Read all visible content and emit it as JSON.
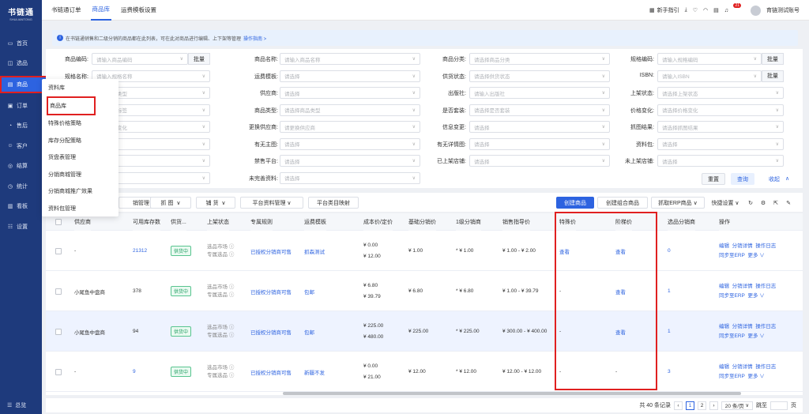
{
  "brand": {
    "name": "书链通",
    "sub": "SHULIANTONG"
  },
  "sidebar": {
    "items": [
      {
        "label": "首页",
        "icon": "monitor-icon"
      },
      {
        "label": "选品",
        "icon": "select-icon"
      },
      {
        "label": "商品",
        "icon": "goods-icon"
      },
      {
        "label": "订单",
        "icon": "order-icon"
      },
      {
        "label": "售后",
        "icon": "aftersale-icon"
      },
      {
        "label": "客户",
        "icon": "customer-icon"
      },
      {
        "label": "结算",
        "icon": "settle-icon"
      },
      {
        "label": "统计",
        "icon": "stats-icon"
      },
      {
        "label": "看板",
        "icon": "board-icon"
      },
      {
        "label": "设置",
        "icon": "settings-icon"
      }
    ],
    "bottom_label": "总览"
  },
  "topbar": {
    "tabs": [
      "书链通订单",
      "商品库",
      "运费模板设置"
    ],
    "active_tab": 1,
    "guide": "新手指引",
    "badge": "21",
    "account": "育链测试账号"
  },
  "notice": {
    "text": "在书链通销售和二级分销的商品都在此列表，可在此对商品进行编辑、上下架等管理",
    "link": "操作指南 >"
  },
  "dropdown": [
    "资料库",
    "商品库",
    "特殊价格策略",
    "库存分配策略",
    "货盘表管理",
    "分销商城管理",
    "分销商城推广效果",
    "资料包管理"
  ],
  "filters": {
    "row1": [
      {
        "label": "商品编码:",
        "placeholder": "请输入商品编码",
        "btn": "批量"
      },
      {
        "label": "商品名称:",
        "placeholder": "请输入商品名称"
      },
      {
        "label": "商品分类:",
        "placeholder": "请选择商品分类"
      },
      {
        "label": "规格编码:",
        "placeholder": "请输入规格编码",
        "btn": "批量"
      }
    ],
    "row2": [
      {
        "label": "规格名称:",
        "placeholder": "请输入规格名称"
      },
      {
        "label": "运费模板:",
        "placeholder": "请选择"
      },
      {
        "label": "供货状态:",
        "placeholder": "请选择供货状态"
      },
      {
        "label": "ISBN:",
        "placeholder": "请输入ISBN",
        "btn": "批量"
      }
    ],
    "row3": [
      {
        "label": "",
        "placeholder": "选择供货类型"
      },
      {
        "label": "供应商:",
        "placeholder": "请选择"
      },
      {
        "label": "出版社:",
        "placeholder": "请输入出版社"
      },
      {
        "label": "上架状态:",
        "placeholder": "请选择上架状态"
      }
    ],
    "row4": [
      {
        "label": "",
        "placeholder": "选择商品标签"
      },
      {
        "label": "商品类型:",
        "placeholder": "请选择商品类型"
      },
      {
        "label": "是否套装:",
        "placeholder": "请选择是否套装"
      },
      {
        "label": "价格变化:",
        "placeholder": "请选择价格变化"
      }
    ],
    "row5": [
      {
        "label": "",
        "placeholder": "选择库存变化"
      },
      {
        "label": "更换供应商:",
        "placeholder": "请更换供应商"
      },
      {
        "label": "信息变更:",
        "placeholder": "请选择"
      },
      {
        "label": "抓图结果:",
        "placeholder": "请选择抓图结果"
      }
    ],
    "row6": [
      {
        "label": "",
        "placeholder": "请选择"
      },
      {
        "label": "有无主图:",
        "placeholder": "请选择"
      },
      {
        "label": "有无详情图:",
        "placeholder": "请选择"
      },
      {
        "label": "资料包:",
        "placeholder": "请选择"
      }
    ],
    "row7": [
      {
        "label": "",
        "placeholder": "请选择"
      },
      {
        "label": "禁售平台:",
        "placeholder": "请选择"
      },
      {
        "label": "已上架店铺:",
        "placeholder": "请选择"
      },
      {
        "label": "未上架店铺:",
        "placeholder": "请选择"
      }
    ],
    "row8": [
      {
        "label": "",
        "placeholder": "请选择"
      },
      {
        "label": "未完善资料:",
        "placeholder": "请选择"
      }
    ],
    "reset": "重置",
    "search": "查询",
    "collapse": "收起"
  },
  "toolbar": {
    "left": [
      "销管理",
      "抓 图",
      "铺 货",
      "平台资料管理",
      "平台类目映射"
    ],
    "right": [
      "创建商品",
      "创建组合商品",
      "抓取ERP商品",
      "快捷设置"
    ]
  },
  "table": {
    "headers": [
      "供应商",
      "可用库存数",
      "供货...",
      "上架状态",
      "专属规则",
      "运费模板",
      "成本价/定价",
      "基础分销价",
      "1级分销商",
      "销售指导价",
      "特殊价",
      "阶梯价",
      "选品分销商",
      "操作"
    ],
    "rows": [
      {
        "supplier": "-",
        "stock": "21312",
        "status": "供货中",
        "listing": [
          "选品市场",
          "专属选品"
        ],
        "rule": "已授权分销商可售",
        "freight": "抓森测试",
        "cost": [
          "¥ 0.00",
          "¥ 12.00"
        ],
        "base": "¥ 1.00",
        "lv1": "* ¥ 1.00",
        "guide": "¥ 1.00 - ¥ 2.00",
        "special": "查看",
        "tier": "查看",
        "pick": "0"
      },
      {
        "supplier": "小尾鱼中盘商",
        "stock": "378",
        "status": "供货中",
        "listing": [
          "选品市场",
          "专属选品"
        ],
        "rule": "已授权分销商可售",
        "freight": "包邮",
        "cost": [
          "¥ 6.80",
          "¥ 39.79"
        ],
        "base": "¥ 6.80",
        "lv1": "* ¥ 6.80",
        "guide": "¥ 1.00 - ¥ 39.79",
        "special": "-",
        "tier": "查看",
        "pick": "1"
      },
      {
        "supplier": "小尾鱼中盘商",
        "stock": "94",
        "status": "供货中",
        "listing": [
          "选品市场",
          "专属选品"
        ],
        "rule": "已授权分销商可售",
        "freight": "包邮",
        "cost": [
          "¥ 225.00",
          "¥ 480.00"
        ],
        "base": "¥ 225.00",
        "lv1": "* ¥ 225.00",
        "guide": "¥ 300.00 - ¥ 400.00",
        "special": "-",
        "tier": "查看",
        "pick": "1"
      },
      {
        "supplier": "-",
        "stock": "9",
        "status": "供货中",
        "listing": [
          "选品市场",
          "专属选品"
        ],
        "rule": "已授权分销商可售",
        "freight": "新疆不发",
        "cost": [
          "¥ 0.00",
          "¥ 21.00"
        ],
        "base": "¥ 12.00",
        "lv1": "* ¥ 12.00",
        "guide": "¥ 12.00 - ¥ 12.00",
        "special": "-",
        "tier": "-",
        "pick": "3"
      }
    ],
    "ops": [
      "编辑",
      "分销详情",
      "操作日志",
      "同步至ERP",
      "更多"
    ]
  },
  "pager": {
    "total": "共 40 条记录",
    "pages": [
      "1",
      "2"
    ],
    "size": "20 条/页",
    "jump": "跳至",
    "page_unit": "页"
  }
}
